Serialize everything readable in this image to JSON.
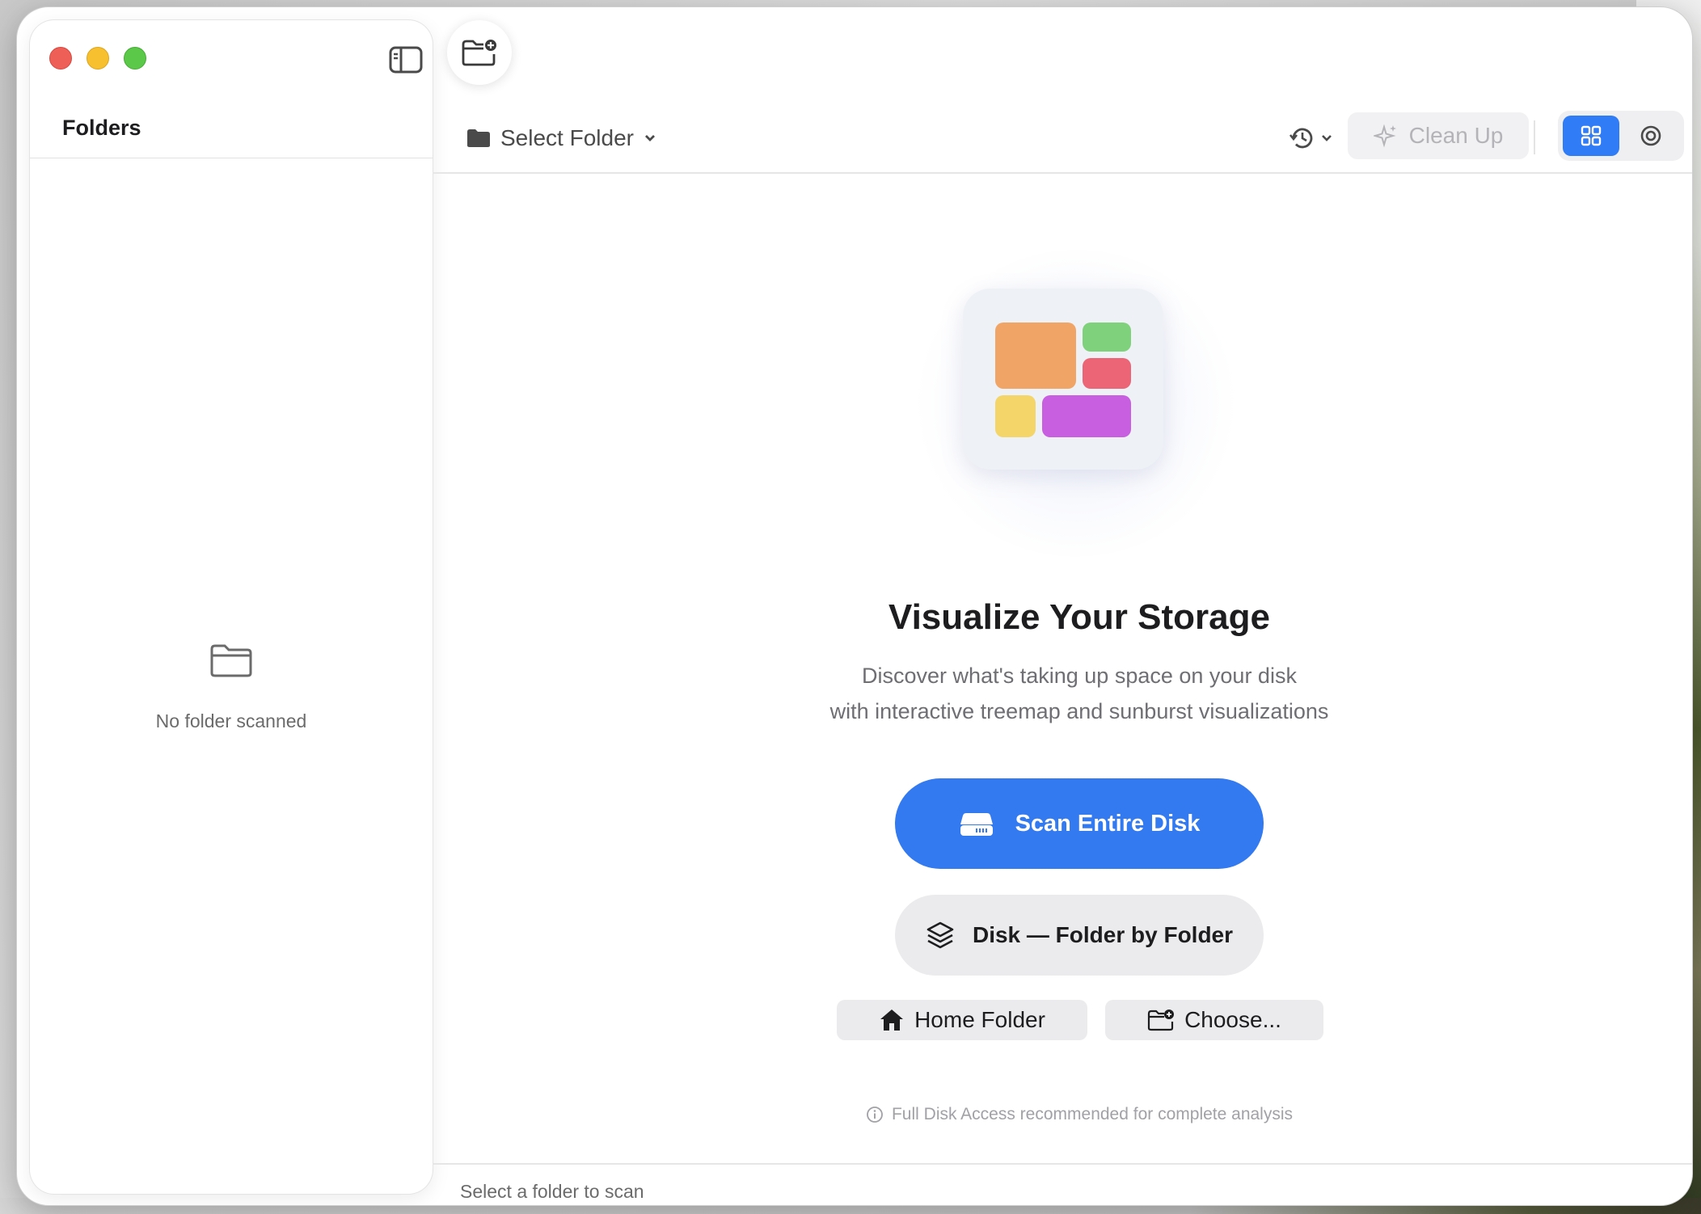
{
  "sidebar": {
    "title": "Folders",
    "empty_message": "No folder scanned"
  },
  "toolbar": {
    "select_folder_label": "Select Folder",
    "cleanup_label": "Clean Up",
    "view_modes": [
      "treemap",
      "sunburst"
    ],
    "active_view": "treemap"
  },
  "hero": {
    "title": "Visualize Your Storage",
    "subtitle_line1": "Discover what's taking up space on your disk",
    "subtitle_line2": "with interactive treemap and sunburst visualizations",
    "tile_colors": [
      "#f0a567",
      "#7fd17b",
      "#eb6577",
      "#f4d56a",
      "#c75fe0"
    ]
  },
  "actions": {
    "scan_entire_disk": "Scan Entire Disk",
    "disk_folder_by_folder": "Disk — Folder by Folder",
    "home_folder": "Home Folder",
    "choose": "Choose..."
  },
  "notice": {
    "full_disk_access": "Full Disk Access recommended for complete analysis"
  },
  "status_bar": {
    "text": "Select a folder to scan"
  },
  "colors": {
    "accent": "#3379f0",
    "close": "#ee5f57",
    "minimize": "#f6c02e",
    "maximize": "#5cc84a"
  }
}
